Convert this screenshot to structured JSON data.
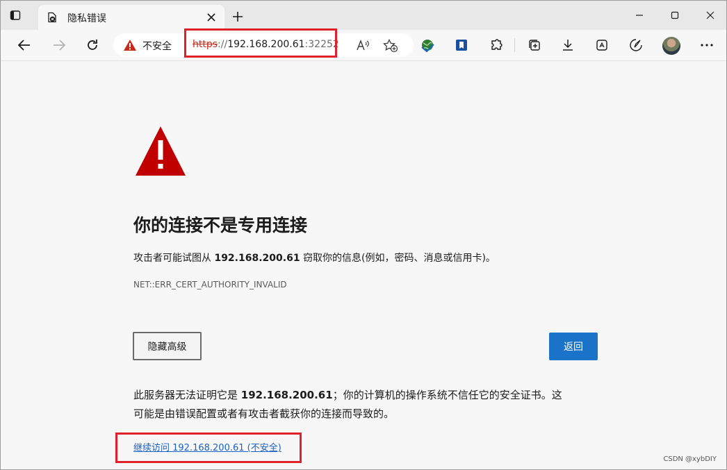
{
  "tab": {
    "title": "隐私错误"
  },
  "addressbar": {
    "security_label": "不安全",
    "url_scheme": "https",
    "url_separator": "://",
    "url_host": "192.168.200.61",
    "url_port": ":32252"
  },
  "page": {
    "heading": "你的连接不是专用连接",
    "desc_prefix": "攻击者可能试图从 ",
    "desc_host": "192.168.200.61",
    "desc_suffix": " 窃取你的信息(例如，密码、消息或信用卡)。",
    "error_code": "NET::ERR_CERT_AUTHORITY_INVALID",
    "advanced_button": "隐藏高级",
    "back_button": "返回",
    "detail_prefix": "此服务器无法证明它是 ",
    "detail_host": "192.168.200.61",
    "detail_suffix": "；你的计算机的操作系统不信任它的安全证书。这",
    "detail_line2": "可能是由错误配置或者有攻击者截获你的连接而导致的。",
    "proceed_link": "继续访问 192.168.200.61 (不安全)"
  },
  "watermark": "CSDN @xybDIY",
  "colors": {
    "accent_blue": "#1a73c9",
    "link_blue": "#1a61c4",
    "warning_red": "#c00000",
    "highlight_red": "#e0202a"
  }
}
